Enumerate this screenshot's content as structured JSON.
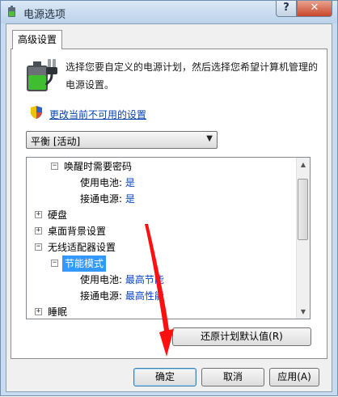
{
  "window": {
    "title": "电源选项",
    "help_label": "?",
    "close_label": "✕"
  },
  "tab": {
    "label": "高级设置"
  },
  "description": "选择您要自定义的电源计划，然后选择您希望计算机管理的电源设置。",
  "change_link": "更改当前不可用的设置",
  "plan_select": {
    "value": "平衡 [活动]"
  },
  "tree": {
    "wake_password": {
      "label": "唤醒时需要密码"
    },
    "wake_battery": {
      "label": "使用电池:",
      "value": "是"
    },
    "wake_plugged": {
      "label": "接通电源:",
      "value": "是"
    },
    "hard_disk": {
      "label": "硬盘"
    },
    "desktop_bg": {
      "label": "桌面背景设置"
    },
    "wireless": {
      "label": "无线适配器设置"
    },
    "power_save_mode": {
      "label": "节能模式"
    },
    "ps_battery": {
      "label": "使用电池:",
      "value": "最高节能"
    },
    "ps_plugged": {
      "label": "接通电源:",
      "value": "最高性能"
    },
    "sleep": {
      "label": "睡眠"
    }
  },
  "buttons": {
    "restore": "还原计划默认值(R)",
    "ok": "确定",
    "cancel": "取消",
    "apply": "应用(A)"
  },
  "colors": {
    "title_bar": "#bcd2ea",
    "close_button": "#c8462c",
    "selection": "#3399ff",
    "link": "#0645ad",
    "annotation_arrow": "#ff0000"
  }
}
